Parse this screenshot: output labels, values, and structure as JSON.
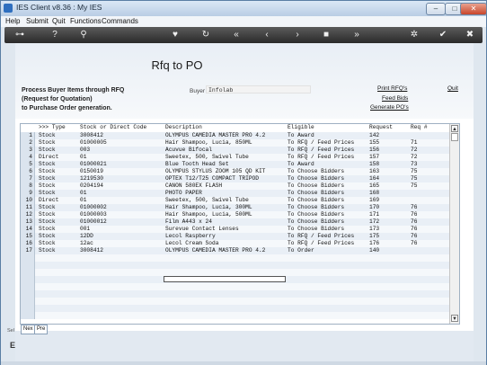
{
  "window": {
    "title": "IES Client v8.36 : My IES",
    "controls": [
      "–",
      "□",
      "✕"
    ]
  },
  "menu": [
    "Help",
    "Submit",
    "Quit",
    "Functions",
    "Commands"
  ],
  "toolbar_icons": [
    "key-icon",
    "help-icon",
    "search-icon",
    "heart-icon",
    "refresh-icon",
    "rewind-icon",
    "back-icon",
    "forward-icon",
    "stop-icon",
    "fast-forward-icon",
    "gear-icon",
    "check-icon",
    "close-icon"
  ],
  "page": {
    "title": "Rfq to PO",
    "desc_line1": "Process Buyer Items through RFQ",
    "desc_line2": "(Request for Quotation)",
    "desc_line3": "to Purchase Order generation.",
    "buyer_label": "Buyer",
    "buyer_value": "Infolab",
    "link_print": "Print RFQ's",
    "link_feed": "Feed Bids",
    "link_generate": "Generate PO's",
    "link_quit": "Quit"
  },
  "grid": {
    "headers": [
      ">>> Type",
      "Stock or Direct Code",
      "Description",
      "Eligible",
      "Request",
      "Req #"
    ],
    "rows": [
      {
        "n": "1",
        "type": "Stock",
        "code": "3008412",
        "desc": "OLYMPUS CAMEDIA MASTER PRO 4.2",
        "elig": "To Award",
        "req": "142",
        "reqno": ""
      },
      {
        "n": "2",
        "type": "Stock",
        "code": "01000005",
        "desc": "Hair Shampoo, Lucia, 850ML",
        "elig": "To RFQ / Feed Prices",
        "req": "155",
        "reqno": "71"
      },
      {
        "n": "3",
        "type": "Stock",
        "code": "003",
        "desc": "Acuvue Bifocal",
        "elig": "To RFQ / Feed Prices",
        "req": "156",
        "reqno": "72"
      },
      {
        "n": "4",
        "type": "Direct",
        "code": "01",
        "desc": "Sweetex, 500, Swivel Tube",
        "elig": "To RFQ / Feed Prices",
        "req": "157",
        "reqno": "72"
      },
      {
        "n": "5",
        "type": "Stock",
        "code": "01000021",
        "desc": "Blue Tooth Head Set",
        "elig": "To Award",
        "req": "158",
        "reqno": "73"
      },
      {
        "n": "6",
        "type": "Stock",
        "code": "0150019",
        "desc": "OLYMPUS STYLUS ZOOM 105 QD KIT",
        "elig": "To Choose Bidders",
        "req": "163",
        "reqno": "75"
      },
      {
        "n": "7",
        "type": "Stock",
        "code": "1219530",
        "desc": "OPTEX T12/T25 COMPACT TRIPOD",
        "elig": "To Choose Bidders",
        "req": "164",
        "reqno": "75"
      },
      {
        "n": "8",
        "type": "Stock",
        "code": "0204194",
        "desc": "CANON 580EX FLASH",
        "elig": "To Choose Bidders",
        "req": "165",
        "reqno": "75"
      },
      {
        "n": "9",
        "type": "Stock",
        "code": "01",
        "desc": "PHOTO PAPER",
        "elig": "To Choose Bidders",
        "req": "168",
        "reqno": ""
      },
      {
        "n": "10",
        "type": "Direct",
        "code": "01",
        "desc": "Sweetex, 500, Swivel Tube",
        "elig": "To Choose Bidders",
        "req": "169",
        "reqno": ""
      },
      {
        "n": "11",
        "type": "Stock",
        "code": "01000002",
        "desc": "Hair Shampoo, Lucia, 300ML",
        "elig": "To Choose Bidders",
        "req": "170",
        "reqno": "76"
      },
      {
        "n": "12",
        "type": "Stock",
        "code": "01000003",
        "desc": "Hair Shampoo, Lucia, 500ML",
        "elig": "To Choose Bidders",
        "req": "171",
        "reqno": "76"
      },
      {
        "n": "13",
        "type": "Stock",
        "code": "01000012",
        "desc": "Film A443 x 24",
        "elig": "To Choose Bidders",
        "req": "172",
        "reqno": "76"
      },
      {
        "n": "14",
        "type": "Stock",
        "code": "001",
        "desc": "Surevue Contact Lenses",
        "elig": "To Choose Bidders",
        "req": "173",
        "reqno": "76"
      },
      {
        "n": "15",
        "type": "Stock",
        "code": "12DD",
        "desc": "Lecol Raspberry",
        "elig": "To RFQ / Feed Prices",
        "req": "175",
        "reqno": "76"
      },
      {
        "n": "16",
        "type": "Stock",
        "code": "12ac",
        "desc": "Lecol Cream Soda",
        "elig": "To RFQ / Feed Prices",
        "req": "176",
        "reqno": "76"
      },
      {
        "n": "17",
        "type": "Stock",
        "code": "3008412",
        "desc": "OLYMPUS CAMEDIA MASTER PRO 4.2",
        "elig": "To Order",
        "req": "140",
        "reqno": ""
      }
    ]
  },
  "nav": {
    "next": "Nex",
    "prev": "Pre"
  },
  "side": {
    "sel": "Sel",
    "e": "E"
  }
}
